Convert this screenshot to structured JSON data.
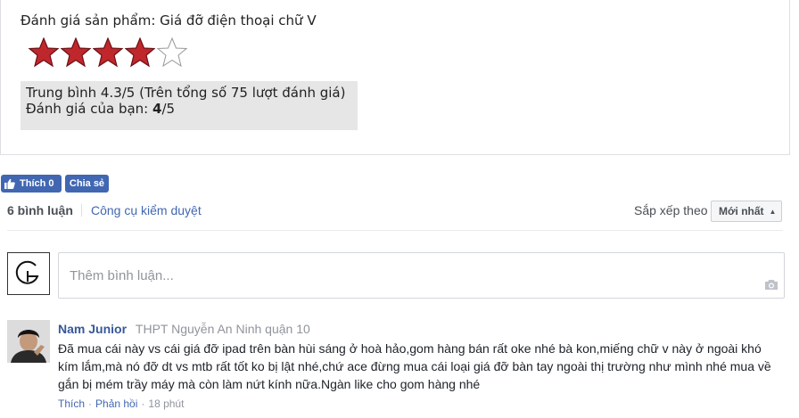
{
  "rating": {
    "title": "Đánh giá sản phẩm: Giá đỡ điện thoại chữ V",
    "stars_filled": 4,
    "stars_total": 5,
    "average_text": "Trung bình 4.3/5 (Trên tổng số 75 lượt đánh giá)",
    "your_rating_label": "Đánh giá của bạn: ",
    "your_rating_value": "4",
    "your_rating_suffix": "/5",
    "star_color": "#c0272d"
  },
  "social": {
    "like_label": "Thích 0",
    "share_label": "Chia sẻ",
    "brand_color": "#4267b2"
  },
  "comments_header": {
    "count_label": "6 bình luận",
    "moderation_link": "Công cụ kiểm duyệt",
    "sort_label": "Sắp xếp theo",
    "sort_value": "Mới nhất"
  },
  "composer": {
    "placeholder": "Thêm bình luận..."
  },
  "comments": [
    {
      "author": "Nam Junior",
      "org": "THPT Nguyễn An Ninh quận 10",
      "text": "Đã mua cái này vs cái giá đỡ ipad trên bàn hùi sáng ở hoà hảo,gom hàng bán rất oke nhé bà kon,miếng chữ v này ở ngoài khó kím lắm,mà nó đỡ dt vs mtb rất tốt ko bị lật nhé,chứ ace đừng mua cái loại giá đỡ bàn tay ngoài thị trường như mình nhé mua về gắn bị mém trầy máy mà còn làm nứt kính nữa.Ngàn like cho gom hàng nhé",
      "like_action": "Thích",
      "reply_action": "Phản hồi",
      "time": "18 phút"
    }
  ]
}
